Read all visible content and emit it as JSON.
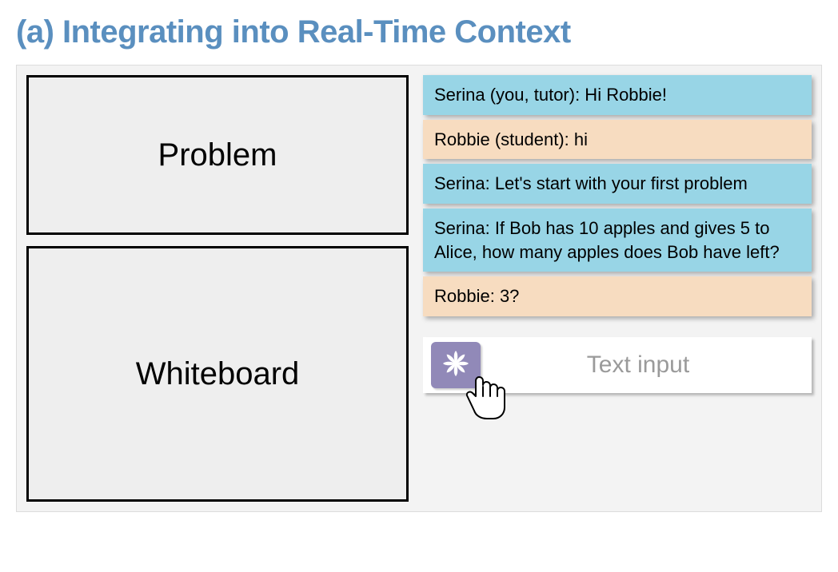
{
  "title": "(a) Integrating into Real-Time Context",
  "left": {
    "problem_label": "Problem",
    "whiteboard_label": "Whiteboard"
  },
  "chat": [
    {
      "role": "tutor",
      "text": "Serina (you, tutor): Hi Robbie!"
    },
    {
      "role": "student",
      "text": "Robbie (student): hi"
    },
    {
      "role": "tutor",
      "text": "Serina: Let's start with your first problem"
    },
    {
      "role": "tutor",
      "text": "Serina: If Bob has 10 apples and gives 5 to Alice, how many apples does Bob have left?"
    },
    {
      "role": "student",
      "text": "Robbie: 3?"
    }
  ],
  "input": {
    "placeholder": "Text input"
  },
  "colors": {
    "title": "#5a8fbf",
    "tutor_bubble": "#98d5e6",
    "student_bubble": "#f7dcc0",
    "ai_button": "#9189b8"
  }
}
